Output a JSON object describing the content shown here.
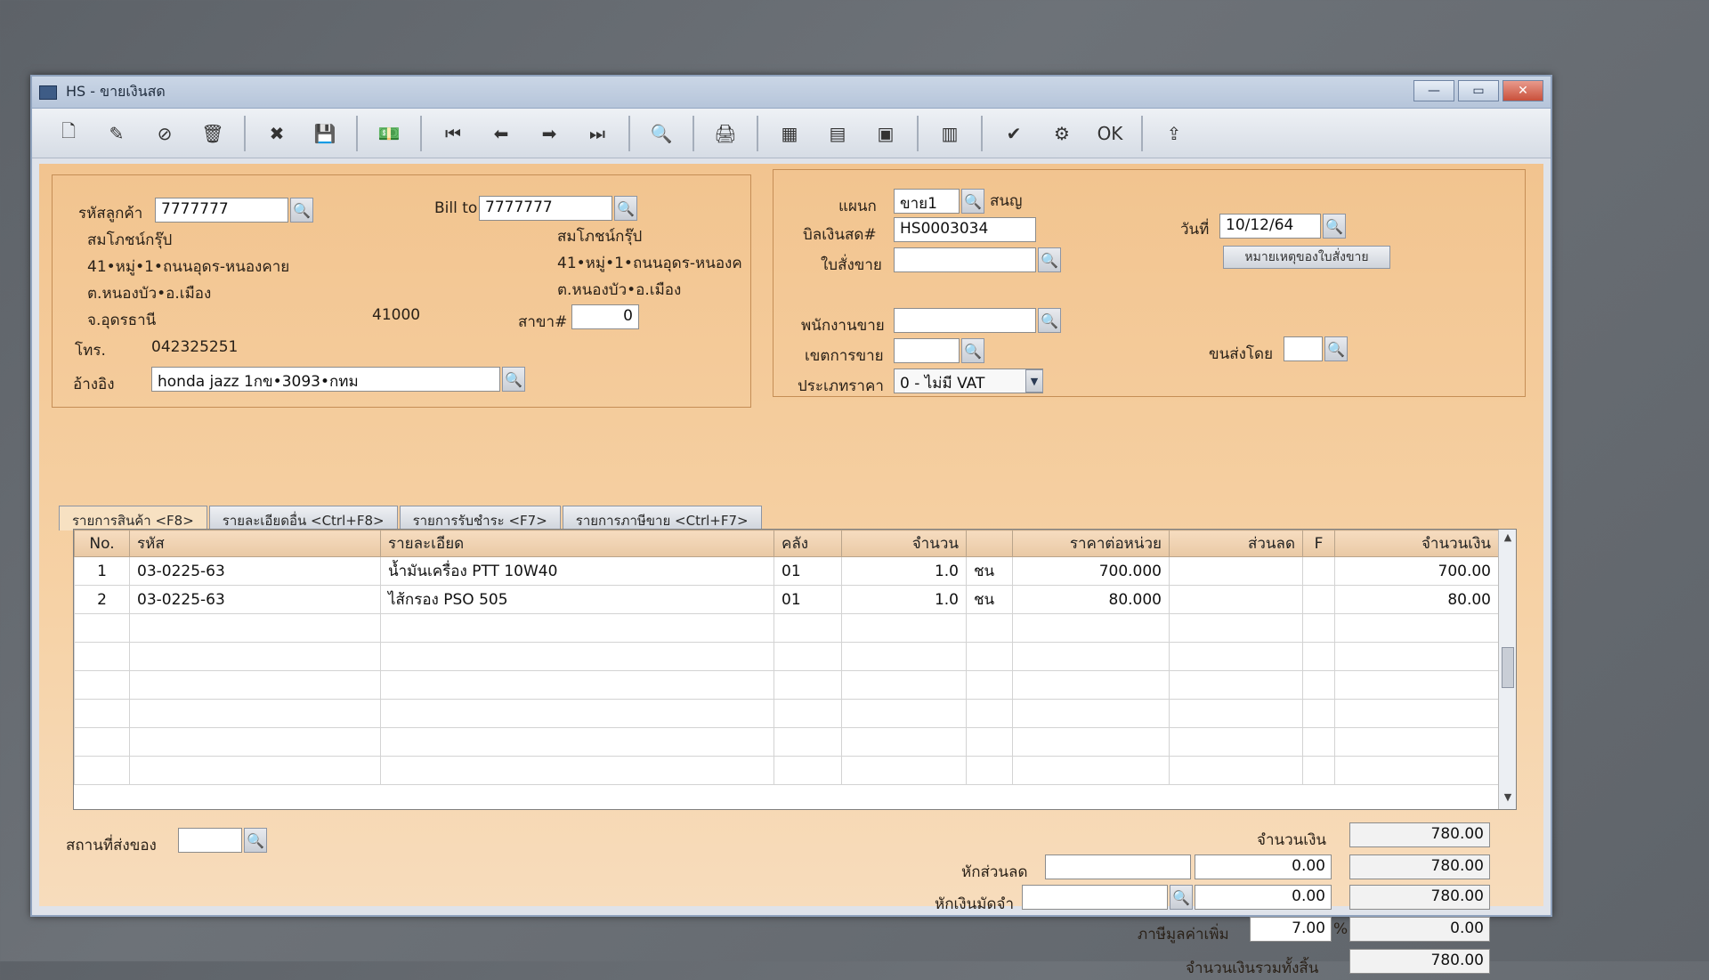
{
  "window": {
    "title": "HS - ขายเงินสด"
  },
  "toolbar": {
    "buttons": [
      {
        "name": "new-doc-icon",
        "glyph": "🗋"
      },
      {
        "name": "edit-icon",
        "glyph": "✎"
      },
      {
        "name": "void-icon",
        "glyph": "⊘"
      },
      {
        "name": "trash-icon",
        "glyph": "🗑"
      },
      {
        "name": "cancel-icon",
        "glyph": "✖"
      },
      {
        "name": "save-icon",
        "glyph": "💾"
      },
      {
        "name": "money-icon",
        "glyph": "💵"
      },
      {
        "name": "first-record-icon",
        "glyph": "⏮"
      },
      {
        "name": "prev-record-icon",
        "glyph": "⬅"
      },
      {
        "name": "next-record-icon",
        "glyph": "➡"
      },
      {
        "name": "last-record-icon",
        "glyph": "⏭"
      },
      {
        "name": "find-icon",
        "glyph": "🔍"
      },
      {
        "name": "print-icon",
        "glyph": "🖨"
      },
      {
        "name": "calculator-icon",
        "glyph": "▦"
      },
      {
        "name": "card-icon",
        "glyph": "▤"
      },
      {
        "name": "screen-icon",
        "glyph": "▣"
      },
      {
        "name": "report-icon",
        "glyph": "▥"
      },
      {
        "name": "approve-icon",
        "glyph": "✔"
      },
      {
        "name": "settings-icon",
        "glyph": "⚙"
      },
      {
        "name": "ok-icon",
        "glyph": "OK"
      },
      {
        "name": "export-icon",
        "glyph": "⇪"
      }
    ]
  },
  "customer": {
    "code_label": "รหัสลูกค้า",
    "code": "7777777",
    "name": "สมโภชน์กรุ๊ป",
    "addr1": "41•หมู่•1•ถนนอุดร-หนองคาย",
    "addr2": "ต.หนองบัว•อ.เมือง",
    "addr3": "จ.อุดรธานี",
    "zip": "41000",
    "phone_label": "โทร.",
    "phone": "042325251",
    "ref_label": "อ้างอิง",
    "ref": "honda jazz 1กข•3093•กทม"
  },
  "billto": {
    "label": "Bill to",
    "code": "7777777",
    "name": "สมโภชน์กรุ๊ป",
    "addr1": "41•หมู่•1•ถนนอุดร-หนองค",
    "addr2": "ต.หนองบัว•อ.เมือง",
    "branch_label": "สาขา#",
    "branch": "0"
  },
  "doc": {
    "dept_label": "แผนก",
    "dept": "ขาย1",
    "dept_name": "สนญ",
    "bill_label": "บิลเงินสด#",
    "bill": "HS0003034",
    "order_label": "ใบสั่งขาย",
    "order": "",
    "date_label": "วันที่",
    "date": "10/12/64",
    "note_button": "หมายเหตุของใบสั่งขาย",
    "salesman_label": "พนักงานขาย",
    "salesman": "",
    "area_label": "เขตการขาย",
    "area": "",
    "ship_label": "ขนส่งโดย",
    "ship": "",
    "price_type_label": "ประเภทราคา",
    "price_type": "0 - ไม่มี VAT"
  },
  "tabs": [
    {
      "label": "รายการสินค้า <F8>"
    },
    {
      "label": "รายละเอียดอื่น <Ctrl+F8>"
    },
    {
      "label": "รายการรับชำระ <F7>"
    },
    {
      "label": "รายการภาษีขาย <Ctrl+F7>"
    }
  ],
  "grid": {
    "headers": [
      "No.",
      "รหัส",
      "รายละเอียด",
      "คลัง",
      "จำนวน",
      "",
      "ราคาต่อหน่วย",
      "ส่วนลด",
      "F",
      "จำนวนเงิน"
    ],
    "rows": [
      [
        "1",
        "03-0225-63",
        "น้ำมันเครื่อง PTT 10W40",
        "01",
        "1.0",
        "ชน",
        "700.000",
        "",
        "",
        "700.00"
      ],
      [
        "2",
        "03-0225-63",
        "ไส้กรอง PSO 505",
        "01",
        "1.0",
        "ชน",
        "80.000",
        "",
        "",
        "80.00"
      ]
    ]
  },
  "footer": {
    "ship_place_label": "สถานที่ส่งของ",
    "ship_place": "",
    "amount_label": "จำนวนเงิน",
    "amount": "780.00",
    "discount_label": "หักส่วนลด",
    "discount_text": "",
    "discount_value": "0.00",
    "discount_total": "780.00",
    "deposit_label": "หักเงินมัดจำ",
    "deposit_text": "",
    "deposit_value": "0.00",
    "deposit_total": "780.00",
    "vat_label": "ภาษีมูลค่าเพิ่ม",
    "vat_rate": "7.00",
    "vat_pct": "%",
    "vat_amount": "0.00",
    "grand_label": "จำนวนเงินรวมทั้งสิ้น",
    "grand_total": "780.00"
  }
}
